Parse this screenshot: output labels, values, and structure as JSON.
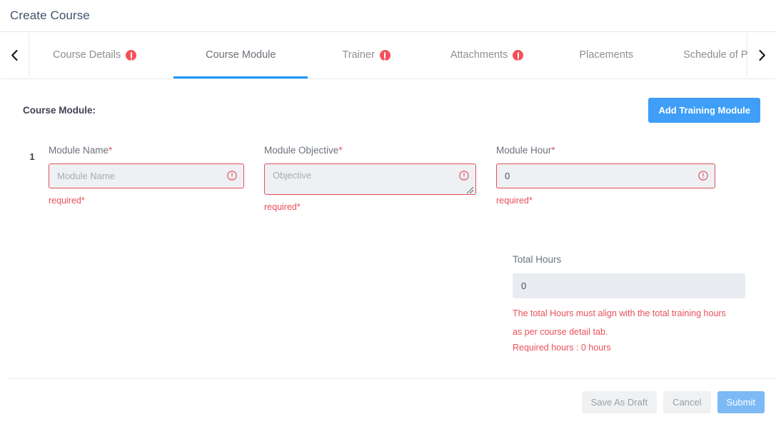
{
  "header": {
    "title": "Create Course"
  },
  "tabs": {
    "prev_arrow_icon": "chevron-left-icon",
    "next_arrow_icon": "chevron-right-icon",
    "items": [
      {
        "label": "Course Details",
        "has_error": true,
        "active": false
      },
      {
        "label": "Course Module",
        "has_error": false,
        "active": true
      },
      {
        "label": "Trainer",
        "has_error": true,
        "active": false
      },
      {
        "label": "Attachments",
        "has_error": true,
        "active": false
      },
      {
        "label": "Placements",
        "has_error": false,
        "active": false
      },
      {
        "label": "Schedule of Price",
        "has_error": true,
        "active": false
      }
    ]
  },
  "module_section": {
    "heading": "Course Module:",
    "add_button_label": "Add Training Module"
  },
  "module_row": {
    "index": "1",
    "name": {
      "label": "Module Name",
      "required_marker": "*",
      "placeholder": "Module Name",
      "value": "",
      "error": "required*"
    },
    "objective": {
      "label": "Module Objective",
      "required_marker": "*",
      "placeholder": "Objective",
      "value": "",
      "error": "required*"
    },
    "hour": {
      "label": "Module Hour",
      "required_marker": "*",
      "placeholder": "0",
      "value": "0",
      "error": "required*"
    }
  },
  "totals": {
    "label": "Total Hours",
    "value": "0",
    "note": "The total Hours must align with the total training hours as per course detail tab.",
    "required_hours": "Required hours : 0 hours"
  },
  "footer": {
    "save_draft_label": "Save As Draft",
    "cancel_label": "Cancel",
    "submit_label": "Submit"
  },
  "colors": {
    "accent_blue": "#3f9ef7",
    "active_tab_underline": "#2196f3",
    "error_red": "#e8505b",
    "badge_red": "#f4505a",
    "submit_blue": "#7cb9f5",
    "input_bg": "#eef0f3",
    "disabled_bg": "#e9ecf0"
  }
}
